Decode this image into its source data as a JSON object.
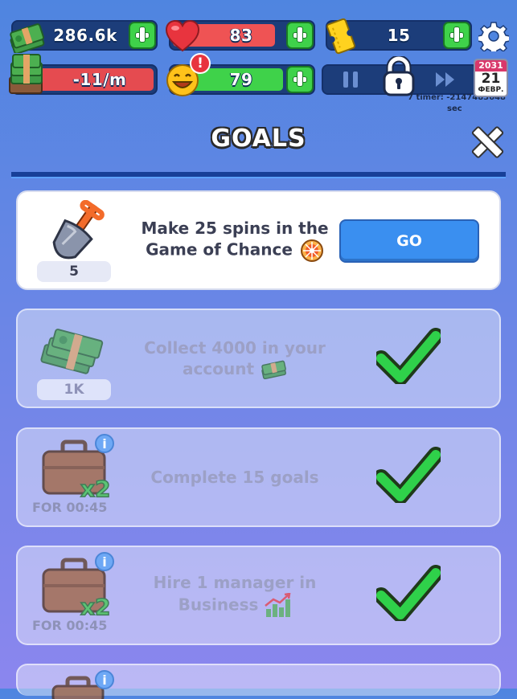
{
  "hud": {
    "money": "286.6k",
    "hearts": "83",
    "hearts_fill_pct": 72,
    "tickets": "15",
    "income": "-11/m",
    "happiness": "79",
    "happiness_fill_pct": 78,
    "timer_label": "7 timer: -2147483648",
    "timer_unit": "sec",
    "calendar": {
      "year": "2031",
      "day": "21",
      "month": "ФЕВР."
    }
  },
  "header": {
    "title": "GOALS"
  },
  "goals": [
    {
      "text": "Make 25 spins in the Game of Chance",
      "reward": "5",
      "reward_icon": "shovel-icon",
      "action": "GO",
      "status": "active"
    },
    {
      "text": "Collect 4000 in your account",
      "reward": "1K",
      "reward_icon": "cash-stack-icon",
      "status": "completed"
    },
    {
      "text": "Complete 15 goals",
      "reward": "FOR 00:45",
      "reward_icon": "briefcase-x2-icon",
      "multiplier": "x2",
      "status": "completed"
    },
    {
      "text": "Hire 1 manager in Business",
      "reward": "FOR 00:45",
      "reward_icon": "briefcase-x2-icon",
      "multiplier": "x2",
      "status": "completed"
    }
  ],
  "colors": {
    "bg_top": "#4f85e0",
    "bg_bottom": "#8b86ee",
    "hearts_bar": "#ef5354",
    "happiness_bar": "#3fd24a",
    "income_bar": "#e54b50",
    "go_button": "#3a8ff0",
    "check": "#2fd14a"
  }
}
